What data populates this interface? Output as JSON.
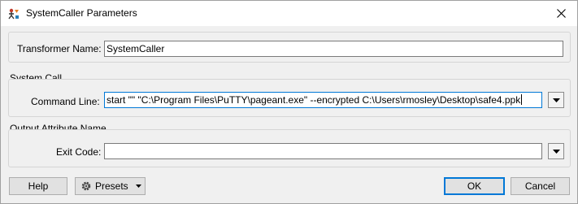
{
  "window": {
    "title": "SystemCaller Parameters",
    "app_icon": "fme-transformer-icon",
    "close_icon": "close-icon"
  },
  "transformer": {
    "label": "Transformer Name:",
    "value": "SystemCaller"
  },
  "system_call": {
    "group_title": "System Call",
    "command_label": "Command Line:",
    "command_value": "start \"\" \"C:\\Program Files\\PuTTY\\pageant.exe\" --encrypted C:\\Users\\rmosley\\Desktop\\safe4.ppk"
  },
  "output": {
    "group_title": "Output Attribute Name",
    "exit_code_label": "Exit Code:",
    "exit_code_value": ""
  },
  "footer": {
    "help_label": "Help",
    "presets_label": "Presets",
    "ok_label": "OK",
    "cancel_label": "Cancel"
  },
  "colors": {
    "focus_border": "#0078d7",
    "dialog_bg": "#f0f0f0"
  }
}
